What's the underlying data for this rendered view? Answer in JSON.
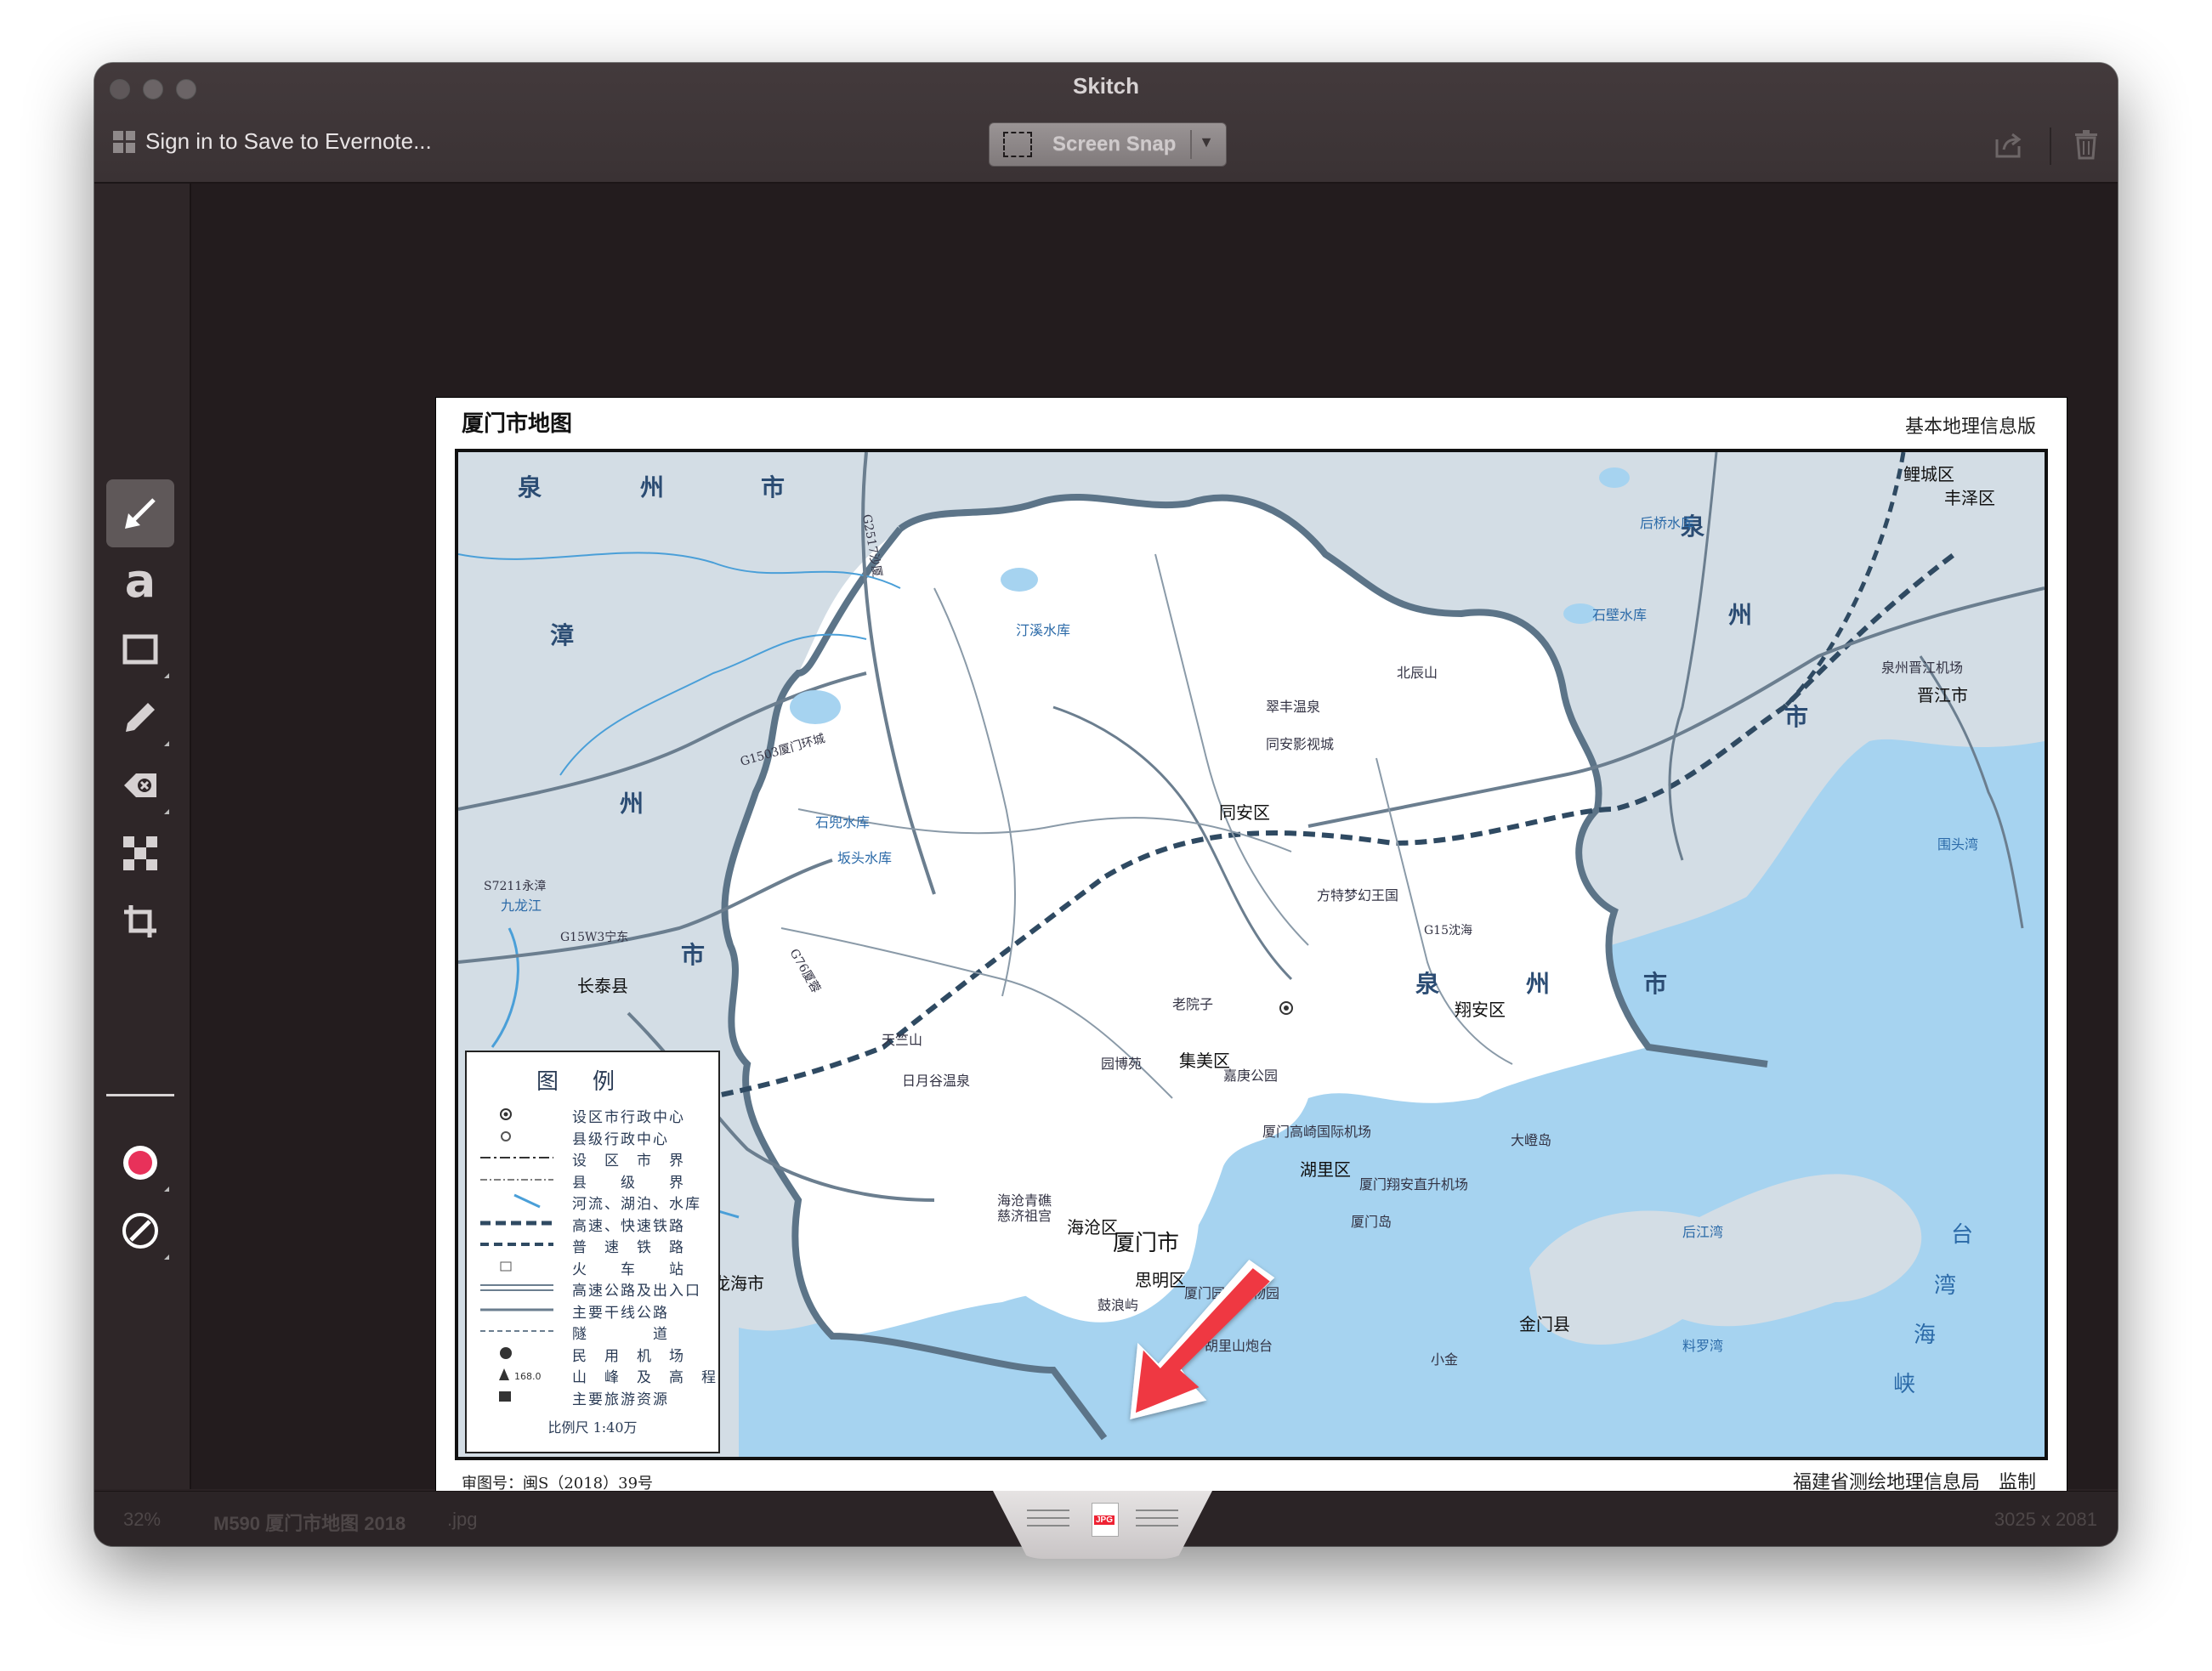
{
  "window": {
    "title": "Skitch",
    "signin_label": "Sign in to Save to Evernote...",
    "snap_label": "Screen Snap"
  },
  "toolbar": {
    "tools": [
      "arrow-tool",
      "text-tool",
      "rectangle-tool",
      "pen-tool",
      "highlighter-tool",
      "pixelate-tool",
      "crop-tool"
    ],
    "text_tool_glyph": "a",
    "color_accent": "#e8315a"
  },
  "map": {
    "title": "厦门市地图",
    "subtitle": "基本地理信息版",
    "approval": "审图号：闽S（2018）39号",
    "credit": "福建省测绘地理信息局　监制",
    "legend": {
      "title": "图例",
      "items": [
        "设区市行政中心",
        "县级行政中心",
        "设　区　市　界",
        "县　　级　　界",
        "河流、湖泊、水库",
        "高速、快速铁路",
        "普　速　铁　路",
        "火　　车　　站",
        "高速公路及出入口",
        "主要干线公路",
        "隧　　　　道",
        "民　用　机　场",
        "山　峰　及　高　程",
        "主要旅游资源"
      ],
      "elevation_sample": "168.0",
      "scale": "比例尺  1:40万"
    },
    "regions": {
      "quanzhou_top_1": "泉",
      "quanzhou_top_2": "州",
      "quanzhou_top_3": "市",
      "zhang": "漳",
      "zhou": "州",
      "quan_right": "泉",
      "zhou_right": "州",
      "shi_right": "市",
      "shi_bottom": "市",
      "quan_bottom": "泉",
      "zhou_bottom": "州",
      "shi_bottom2": "市"
    },
    "places": {
      "tongan": "同安区",
      "jimei": "集美区",
      "haicang": "海沧区",
      "xiangan": "翔安区",
      "huli": "湖里区",
      "siming": "思明区",
      "xiamen": "厦门市",
      "changtai": "长泰县",
      "longhai": "龙海市",
      "jinjiang": "晋江市",
      "jinmen": "金门县",
      "licheng": "鲤城区",
      "fengze": "丰泽区",
      "xiamen_dao": "厦门岛",
      "dadeng": "大嶝岛",
      "gulangyu": "鼓浪屿",
      "tianzhu": "天竺山",
      "beichen": "北辰山",
      "airport_gaoqi": "厦门高崎国际机场",
      "airport_jinjiang": "泉州晋江机场",
      "airport_xiangan": "厦门翔安直升机场",
      "reservoir_tingxi": "汀溪水库",
      "reservoir_shidou": "石兜水库",
      "reservoir_bantou": "坂头水库",
      "reservoir_shibi": "石壁水库",
      "reservoir_houqiao": "后桥水库",
      "fangte": "方特梦幻王国",
      "cuifeng": "翠丰温泉",
      "tongan_film": "同安影视城",
      "laoyuanzi": "老院子",
      "yuanbo": "园博苑",
      "jiageng": "嘉庚公园",
      "riyue": "日月谷温泉",
      "haicang_park": "海沧青礁慈济祖宫",
      "botanical": "厦门园林植物园",
      "hulishan": "胡里山炮台",
      "xiaojin": "小金",
      "taiwan_1": "台",
      "taiwan_2": "湾",
      "taiwan_3": "海",
      "taiwan_4": "峡",
      "g15": "G15沈海",
      "g1503": "G1503厦门环城",
      "g15w3": "G15W3宁东",
      "s7211": "S7211永漳",
      "g76": "G76厦蓉",
      "g2517": "G2517沙厦",
      "weitou": "围头湾",
      "houjiang": "后江湾",
      "liaoluo": "料罗湾",
      "jiulong": "九龙江"
    }
  },
  "status": {
    "zoom": "32%",
    "filename": "M590 厦门市地图 2018",
    "extension": ".jpg",
    "dimensions": "3025 x 2081"
  }
}
